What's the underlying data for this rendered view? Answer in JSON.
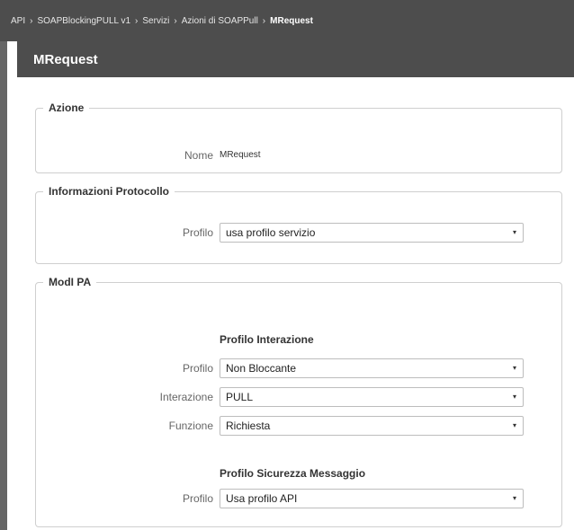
{
  "breadcrumb": {
    "items": [
      "API",
      "SOAPBlockingPULL v1",
      "Servizi",
      "Azioni di SOAPPull"
    ],
    "current": "MRequest",
    "separator": "›"
  },
  "page_title": "MRequest",
  "azione": {
    "legend": "Azione",
    "nome_label": "Nome",
    "nome_value": "MRequest"
  },
  "info_protocollo": {
    "legend": "Informazioni Protocollo",
    "profilo_label": "Profilo",
    "profilo_value": "usa profilo servizio"
  },
  "modipa": {
    "legend": "ModI PA",
    "interazione_heading": "Profilo Interazione",
    "profilo_label": "Profilo",
    "profilo_value": "Non Bloccante",
    "interazione_label": "Interazione",
    "interazione_value": "PULL",
    "funzione_label": "Funzione",
    "funzione_value": "Richiesta",
    "sicurezza_heading": "Profilo Sicurezza Messaggio",
    "sicurezza_profilo_label": "Profilo",
    "sicurezza_profilo_value": "Usa profilo API"
  },
  "colors": {
    "header_bg": "#4d4d4d",
    "border": "#cfcfcf"
  },
  "icons": {
    "caret": "▾"
  }
}
